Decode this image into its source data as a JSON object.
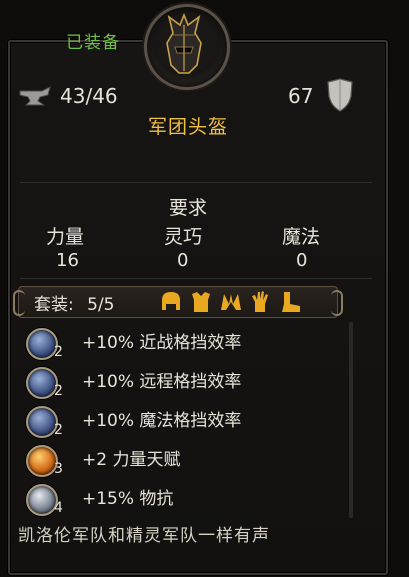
{
  "status": {
    "equipped": "已装备"
  },
  "item": {
    "name": "军团头盔",
    "weight": "43/46",
    "armor": "67",
    "icons": {
      "weight": "anvil-icon",
      "armor": "shield-icon",
      "portrait": "legion-helmet-icon"
    }
  },
  "requirements": {
    "title": "要求",
    "stats": [
      {
        "label": "力量",
        "value": "16"
      },
      {
        "label": "灵巧",
        "value": "0"
      },
      {
        "label": "魔法",
        "value": "0"
      }
    ]
  },
  "set": {
    "label": "套装:",
    "count": "5/5",
    "piece_icons": [
      "helmet-icon",
      "chest-armor-icon",
      "shoulder-armor-icon",
      "gauntlet-icon",
      "boot-icon"
    ],
    "bonuses": [
      {
        "count": "2",
        "text": "+10% 近战格挡效率",
        "icon": "blue-orb-icon"
      },
      {
        "count": "2",
        "text": "+10% 远程格挡效率",
        "icon": "blue-orb-icon"
      },
      {
        "count": "2",
        "text": "+10% 魔法格挡效率",
        "icon": "blue-orb-icon"
      },
      {
        "count": "3",
        "text": "+2 力量天赋",
        "icon": "orange-talent-orb-icon"
      },
      {
        "count": "4",
        "text": "+15% 物抗",
        "icon": "steel-orb-icon"
      }
    ]
  },
  "description": "凯洛伦军队和精灵军队一样有声",
  "colors": {
    "equipped": "#6fc04a",
    "item_name": "#f0c040",
    "set_gold": "#e8a820"
  }
}
